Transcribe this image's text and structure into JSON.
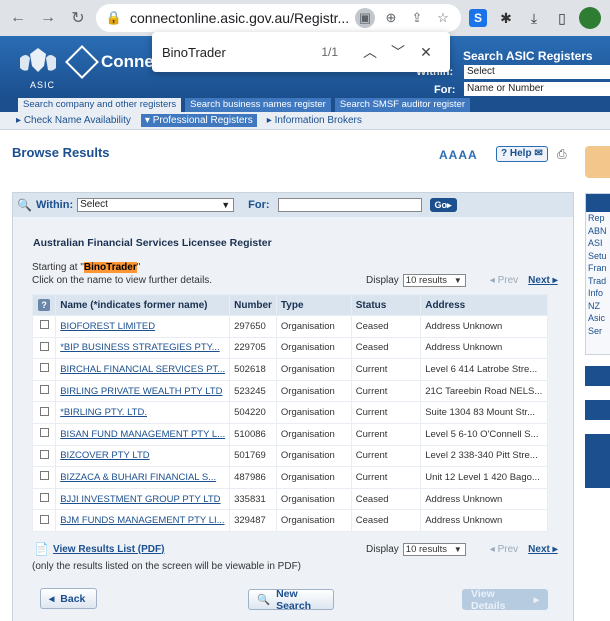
{
  "browser": {
    "url": "connectonline.asic.gov.au/Registr...",
    "find_query": "BinoTrader",
    "find_count": "1/1"
  },
  "header": {
    "brand": "Connec",
    "logo_text": "ASIC",
    "search_registers_title": "Search ASIC Registers",
    "within_label": "Within:",
    "within_value": "Select",
    "for_label": "For:",
    "for_placeholder": "Name or Number"
  },
  "tabs": [
    {
      "label": "Search company and other registers",
      "active": true
    },
    {
      "label": "Search business names register",
      "active": false
    },
    {
      "label": "Search SMSF auditor register",
      "active": false
    }
  ],
  "subnav": [
    {
      "label": "Check Name Availability",
      "active": false
    },
    {
      "label": "Professional Registers",
      "active": true
    },
    {
      "label": "Information Brokers",
      "active": false
    }
  ],
  "page": {
    "title": "Browse Results",
    "font_size_label": "AAAA",
    "help_label": "Help"
  },
  "search_bar": {
    "within_label": "Within:",
    "within_value": "Select",
    "for_label": "For:",
    "go_label": "Go"
  },
  "results": {
    "register_title": "Australian Financial Services Licensee Register",
    "starting_prefix": "Starting at \"",
    "starting_term": "BinoTrader",
    "starting_suffix": "\"",
    "click_note": "Click on the name to view further details.",
    "display_label": "Display",
    "display_value": "10 results",
    "prev_label": "Prev",
    "next_label": "Next",
    "columns": [
      "?",
      "Name (*indicates former name)",
      "Number",
      "Type",
      "Status",
      "Address"
    ],
    "rows": [
      {
        "name": "BIOFOREST LIMITED",
        "number": "297650",
        "type": "Organisation",
        "status": "Ceased",
        "address": "Address Unknown"
      },
      {
        "name": "*BIP BUSINESS STRATEGIES PTY...",
        "number": "229705",
        "type": "Organisation",
        "status": "Ceased",
        "address": "Address Unknown"
      },
      {
        "name": "BIRCHAL FINANCIAL SERVICES PT...",
        "number": "502618",
        "type": "Organisation",
        "status": "Current",
        "address": "Level 6 414 Latrobe Stre..."
      },
      {
        "name": "BIRLING PRIVATE WEALTH PTY LTD",
        "number": "523245",
        "type": "Organisation",
        "status": "Current",
        "address": "21C Tareebin Road NELS..."
      },
      {
        "name": "*BIRLING PTY. LTD.",
        "number": "504220",
        "type": "Organisation",
        "status": "Current",
        "address": "Suite 1304 83 Mount Str..."
      },
      {
        "name": "BISAN FUND MANAGEMENT PTY L...",
        "number": "510086",
        "type": "Organisation",
        "status": "Current",
        "address": "Level 5 6-10 O'Connell S..."
      },
      {
        "name": "BIZCOVER PTY LTD",
        "number": "501769",
        "type": "Organisation",
        "status": "Current",
        "address": "Level 2 338-340 Pitt Stre..."
      },
      {
        "name": "BIZZACA & BUHARI FINANCIAL S...",
        "number": "487986",
        "type": "Organisation",
        "status": "Current",
        "address": "Unit 12 Level 1 420 Bago..."
      },
      {
        "name": "BJJI INVESTMENT GROUP PTY LTD",
        "number": "335831",
        "type": "Organisation",
        "status": "Ceased",
        "address": "Address Unknown"
      },
      {
        "name": "BJM FUNDS MANAGEMENT PTY LI...",
        "number": "329487",
        "type": "Organisation",
        "status": "Ceased",
        "address": "Address Unknown"
      }
    ],
    "pdf_link": "View Results List (PDF)",
    "pdf_note": "(only the results listed on the screen will be viewable in PDF)"
  },
  "buttons": {
    "back": "Back",
    "new_search": "New Search",
    "view_details": "View Details"
  },
  "sidebar": {
    "links": [
      "Rep",
      "ABN",
      "ASI",
      "Setu",
      "Fran",
      "Trad",
      "Info",
      "NZ",
      "Asic",
      "Ser"
    ]
  }
}
